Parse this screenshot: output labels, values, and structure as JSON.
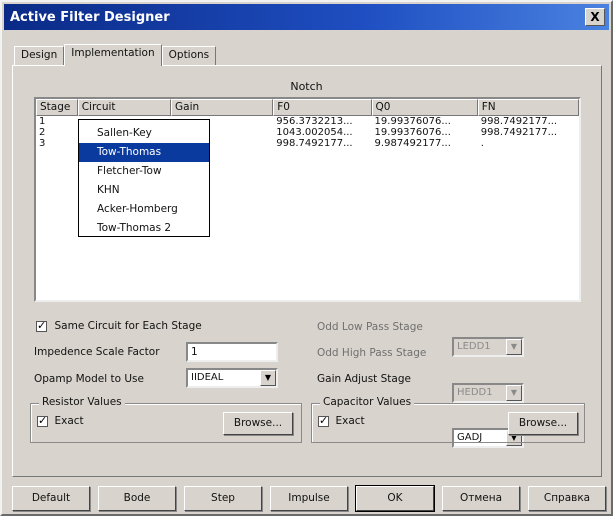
{
  "window": {
    "title": "Active Filter Designer",
    "close_label": "X"
  },
  "tabs": [
    "Design",
    "Implementation",
    "Options"
  ],
  "active_tab": 1,
  "section_title": "Notch",
  "table": {
    "headers": [
      "Stage",
      "Circuit",
      "Gain",
      "F0",
      "Q0",
      "FN"
    ],
    "rows": [
      [
        "1",
        "",
        "",
        "956.3732213...",
        "19.99376076...",
        "998.7492177..."
      ],
      [
        "2",
        "",
        "",
        "1043.002054...",
        "19.99376076...",
        "998.7492177..."
      ],
      [
        "3",
        "",
        "",
        "998.7492177...",
        "9.987492177...",
        "."
      ]
    ]
  },
  "circuit_dropdown": {
    "options": [
      "Sallen-Key",
      "Tow-Thomas",
      "Fletcher-Tow",
      "KHN",
      "Acker-Homberg",
      "Tow-Thomas 2"
    ],
    "selected_index": 1
  },
  "same_circuit": {
    "label": "Same Circuit for Each Stage",
    "checked": true
  },
  "impedance": {
    "label": "Impedence Scale Factor",
    "value": "1"
  },
  "opamp": {
    "label": "Opamp Model to Use",
    "value": "IIDEAL"
  },
  "odd_low_pass": {
    "label": "Odd Low Pass Stage",
    "value": "LEDD1"
  },
  "odd_high_pass": {
    "label": "Odd High Pass Stage",
    "value": "HEDD1"
  },
  "gain_adjust": {
    "label": "Gain Adjust Stage",
    "value": "GADJ"
  },
  "resistor_values": {
    "title": "Resistor Values",
    "exact_label": "Exact",
    "exact_checked": true,
    "browse_label": "Browse..."
  },
  "capacitor_values": {
    "title": "Capacitor Values",
    "exact_label": "Exact",
    "exact_checked": true,
    "browse_label": "Browse..."
  },
  "buttons": {
    "default": "Default",
    "bode": "Bode",
    "step": "Step",
    "impulse": "Impulse",
    "ok": "OK",
    "cancel": "Отмена",
    "help": "Справка"
  }
}
